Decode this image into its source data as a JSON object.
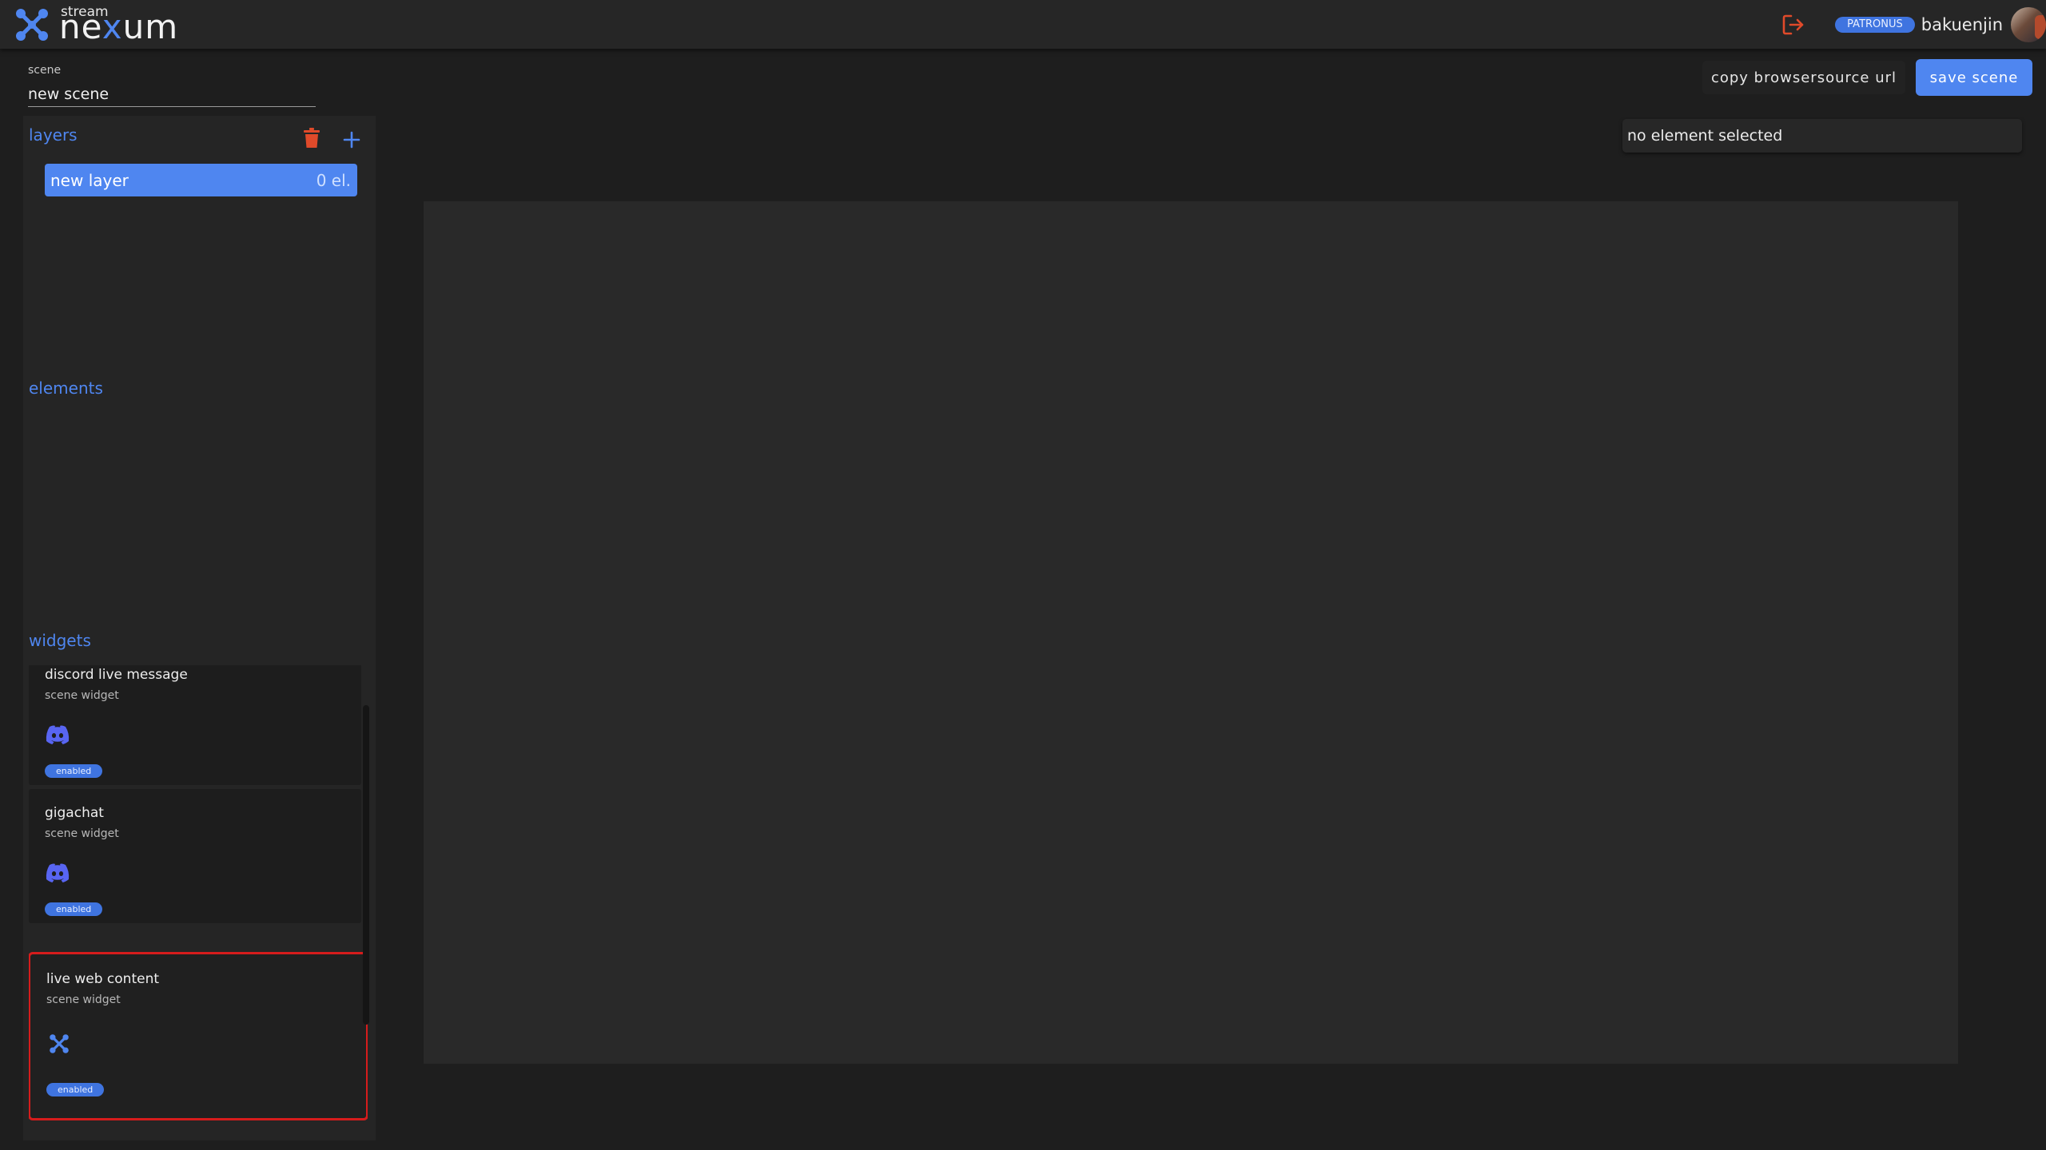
{
  "app": {
    "logo_small": "stream",
    "logo_big_pre": "ne",
    "logo_big_x": "x",
    "logo_big_post": "um",
    "badge": "PATRONUS",
    "username": "bakuenjin",
    "accent_color": "#4f86f0",
    "logout_icon": "logout-icon"
  },
  "scene": {
    "label": "scene",
    "value": "new scene"
  },
  "actions": {
    "copy_label": "copy browsersource url",
    "save_label": "save scene"
  },
  "layers": {
    "header": "layers",
    "items": [
      {
        "label": "new layer",
        "count": "0 el."
      }
    ]
  },
  "elements": {
    "header": "elements"
  },
  "widgets": {
    "header": "widgets",
    "items": [
      {
        "title": "discord live message",
        "subtitle": "scene widget",
        "icon": "discord-icon",
        "status": "enabled"
      },
      {
        "title": "gigachat",
        "subtitle": "scene widget",
        "icon": "discord-icon",
        "status": "enabled"
      },
      {
        "title": "live web content",
        "subtitle": "scene widget",
        "icon": "nexum-icon",
        "status": "enabled"
      }
    ]
  },
  "selection": {
    "text": "no element selected"
  }
}
